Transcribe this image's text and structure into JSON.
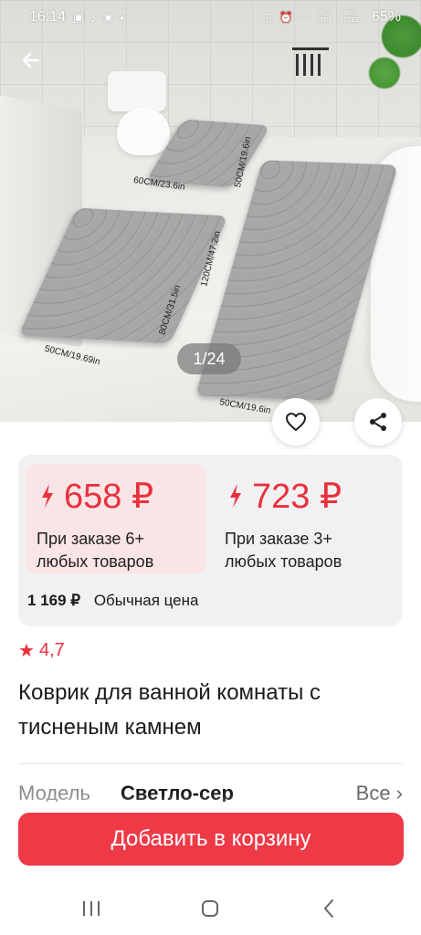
{
  "status_bar": {
    "time": "16:14",
    "battery": "65%",
    "sim1": "Vo)) LTE1",
    "sim2": "Vo)) LTE2"
  },
  "gallery": {
    "counter": "1/24",
    "dimensions": {
      "small_mat_width": "60CM/23.6in",
      "small_mat_height": "50CM/19.6in",
      "medium_mat_width": "50CM/19.69in",
      "medium_mat_height": "80CM/31.5in",
      "large_mat_length": "120CM/47.2in",
      "large_mat_width": "50CM/19.6in"
    }
  },
  "prices": {
    "offer1": {
      "price": "658 ₽",
      "condition_line1": "При заказе 6+",
      "condition_line2": "любых товаров"
    },
    "offer2": {
      "price": "723 ₽",
      "condition_line1": "При заказе 3+",
      "condition_line2": "любых товаров"
    },
    "regular_price": "1 169 ₽",
    "regular_label": "Обычная цена"
  },
  "rating": "4,7",
  "product_title": "Коврик для ванной комнаты с тисненым камнем",
  "attribute": {
    "name": "Модель",
    "value": "Светло-сер",
    "all": "Все ›"
  },
  "add_to_cart": "Добавить в корзину",
  "colors": {
    "accent": "#ee3a47",
    "price_red": "#e8313d",
    "offer_highlight": "#f9e4e6",
    "card_bg": "#f1f1f3"
  },
  "icons": [
    "back-arrow-icon",
    "heart-icon",
    "share-icon",
    "bolt-icon",
    "star-icon",
    "recent-apps-icon",
    "home-icon",
    "nav-back-icon"
  ]
}
